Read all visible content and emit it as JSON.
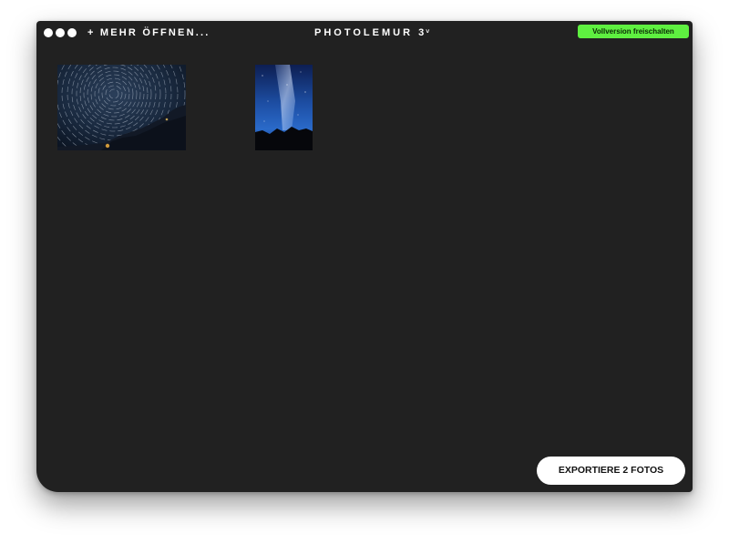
{
  "window": {
    "open_more_label": "+ MEHR ÖFFNEN...",
    "app_title": "PHOTOLEMUR 3",
    "title_caret": "˅",
    "unlock_button_label": "Vollversion freischalten"
  },
  "photos": [
    {
      "name": "star-trails-photo",
      "subject": "star trails over mountain ridge"
    },
    {
      "name": "milky-way-photo",
      "subject": "milky way over mountain silhouette"
    }
  ],
  "footer": {
    "export_button_label": "EXPORTIERE 2 FOTOS"
  },
  "colors": {
    "window_background": "#212121",
    "unlock_button": "#5ef040",
    "export_button": "#ffffff"
  }
}
